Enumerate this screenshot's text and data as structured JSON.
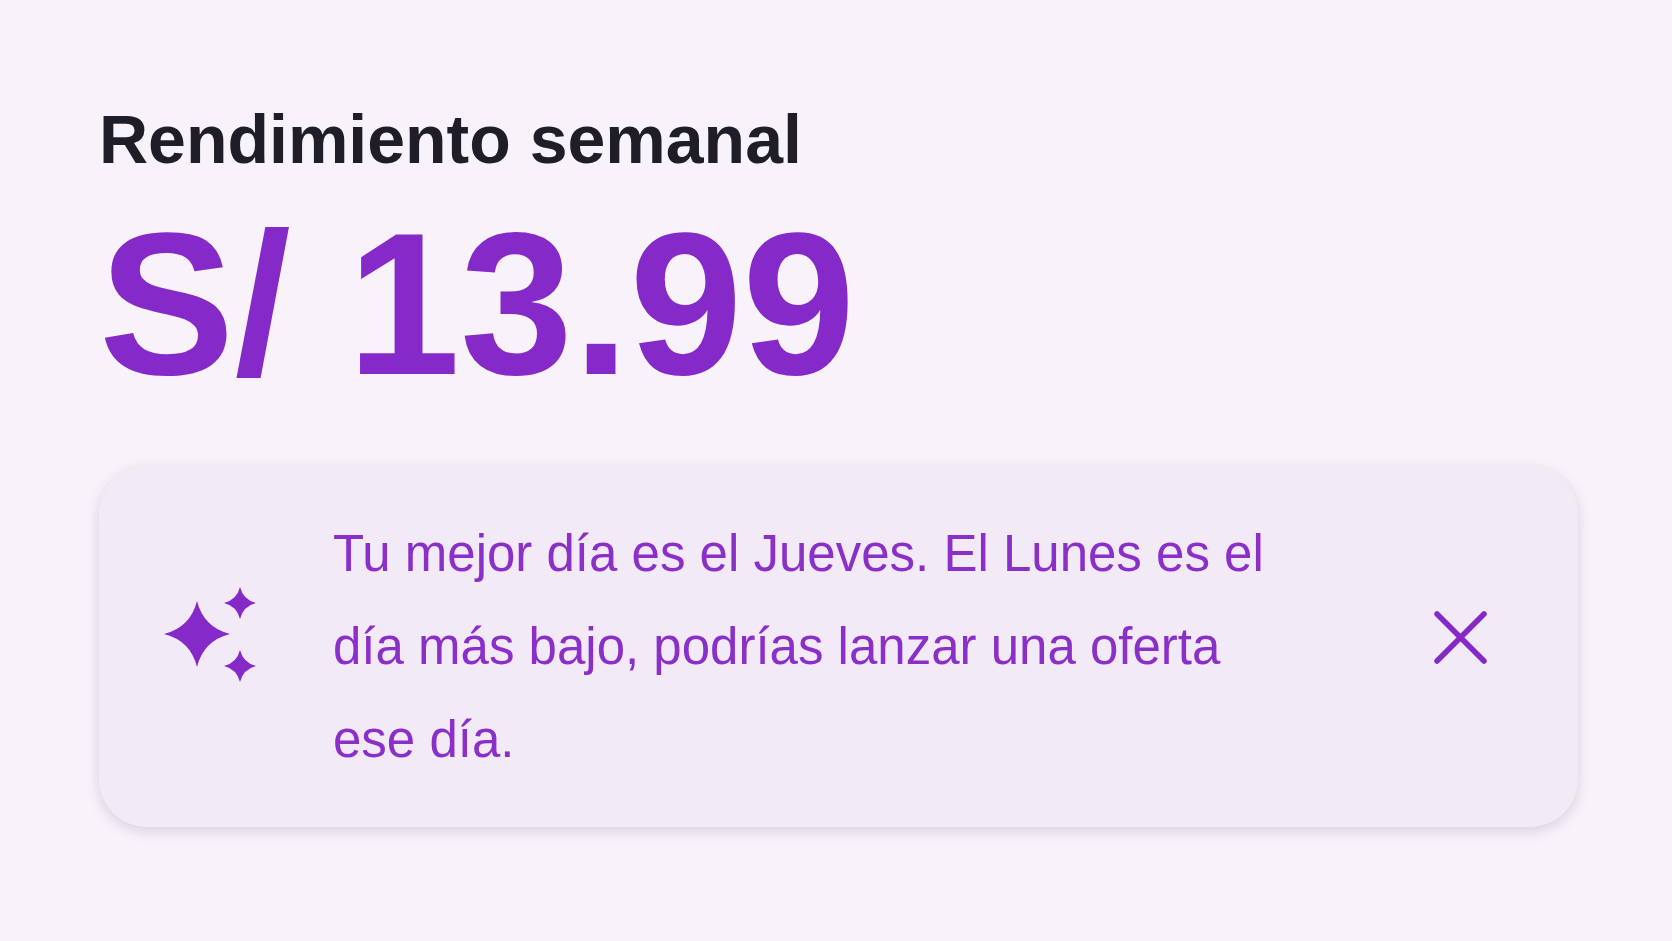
{
  "header": {
    "title": "Rendimiento semanal",
    "amount": "S/ 13.99"
  },
  "insight_card": {
    "message": "Tu mejor día es el Jueves. El Lunes es el día más bajo, podrías lanzar una oferta ese día."
  }
}
